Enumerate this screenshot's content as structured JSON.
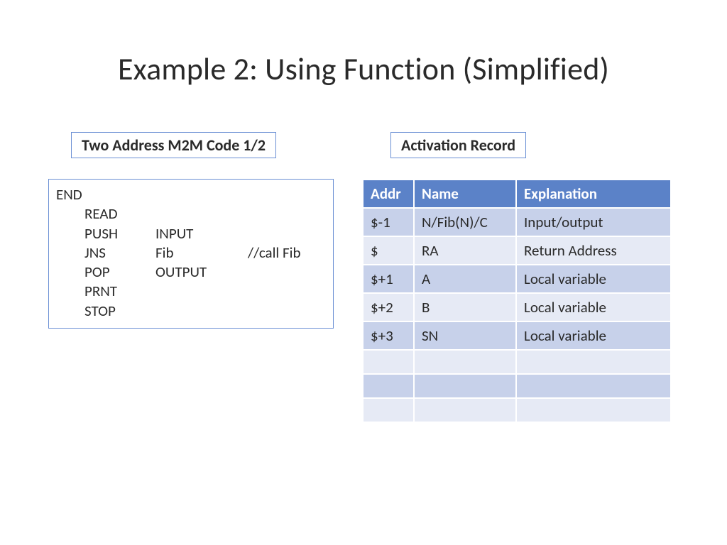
{
  "title": "Example 2: Using Function (Simplified)",
  "left_label": "Two Address M2M Code 1/2",
  "right_label": "Activation Record",
  "code": [
    {
      "c1": "END",
      "c2": "",
      "c3": "",
      "indent": 0
    },
    {
      "c1": "READ",
      "c2": "",
      "c3": "",
      "indent": 1
    },
    {
      "c1": "PUSH",
      "c2": "INPUT",
      "c3": "",
      "indent": 1
    },
    {
      "c1": "JNS",
      "c2": "Fib",
      "c3": "//call Fib",
      "indent": 1
    },
    {
      "c1": "POP",
      "c2": "OUTPUT",
      "c3": "",
      "indent": 1
    },
    {
      "c1": "PRNT",
      "c2": "",
      "c3": "",
      "indent": 1
    },
    {
      "c1": "STOP",
      "c2": "",
      "c3": "",
      "indent": 1
    }
  ],
  "table": {
    "headers": {
      "addr": "Addr",
      "name": "Name",
      "expl": "Explanation"
    },
    "rows": [
      {
        "addr": "$-1",
        "name": "N/Fib(N)/C",
        "expl": "Input/output"
      },
      {
        "addr": "$",
        "name": "RA",
        "expl": "Return Address"
      },
      {
        "addr": "$+1",
        "name": "A",
        "expl": "Local variable"
      },
      {
        "addr": "$+2",
        "name": "B",
        "expl": "Local variable"
      },
      {
        "addr": "$+3",
        "name": "SN",
        "expl": "Local variable"
      },
      {
        "addr": "",
        "name": "",
        "expl": ""
      },
      {
        "addr": "",
        "name": "",
        "expl": ""
      },
      {
        "addr": "",
        "name": "",
        "expl": ""
      }
    ]
  }
}
